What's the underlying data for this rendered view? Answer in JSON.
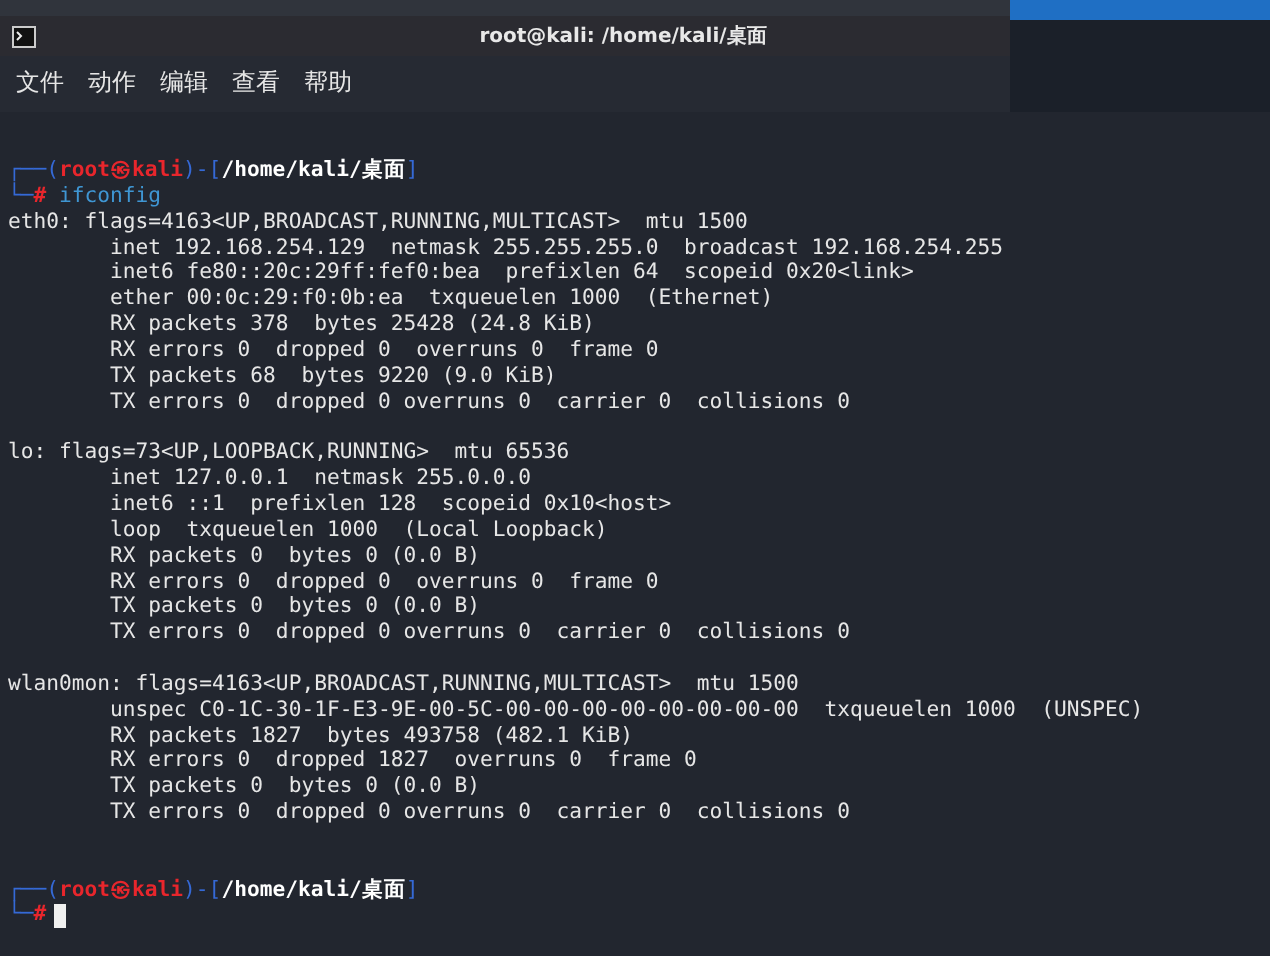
{
  "window": {
    "title": "root@kali: /home/kali/桌面"
  },
  "menu": [
    "文件",
    "动作",
    "编辑",
    "查看",
    "帮助"
  ],
  "terminal": [
    {
      "kind": "prompt",
      "cursor": false,
      "segments": [
        {
          "text": "┌──(",
          "color": "#3569d6"
        },
        {
          "text": "root㉿kali",
          "color": "#e8262c"
        },
        {
          "text": ")-[",
          "color": "#3569d6"
        },
        {
          "text": "/home/kali/桌面",
          "color": "#ffffff"
        },
        {
          "text": "]",
          "color": "#3569d6"
        }
      ],
      "input": [
        {
          "text": "└─",
          "color": "#3569d6"
        },
        {
          "text": "#",
          "color": "#e8262c"
        },
        {
          "text": " ifconfig",
          "color": "#3f96d3"
        }
      ]
    },
    {
      "kind": "output",
      "text": "eth0: flags=4163<UP,BROADCAST,RUNNING,MULTICAST>  mtu 1500"
    },
    {
      "kind": "output",
      "text": "        inet 192.168.254.129  netmask 255.255.255.0  broadcast 192.168.254.255"
    },
    {
      "kind": "output",
      "text": "        inet6 fe80::20c:29ff:fef0:bea  prefixlen 64  scopeid 0x20<link>"
    },
    {
      "kind": "output",
      "text": "        ether 00:0c:29:f0:0b:ea  txqueuelen 1000  (Ethernet)"
    },
    {
      "kind": "output",
      "text": "        RX packets 378  bytes 25428 (24.8 KiB)"
    },
    {
      "kind": "output",
      "text": "        RX errors 0  dropped 0  overruns 0  frame 0"
    },
    {
      "kind": "output",
      "text": "        TX packets 68  bytes 9220 (9.0 KiB)"
    },
    {
      "kind": "output",
      "text": "        TX errors 0  dropped 0 overruns 0  carrier 0  collisions 0"
    },
    {
      "kind": "blank"
    },
    {
      "kind": "output",
      "text": "lo: flags=73<UP,LOOPBACK,RUNNING>  mtu 65536"
    },
    {
      "kind": "output",
      "text": "        inet 127.0.0.1  netmask 255.0.0.0"
    },
    {
      "kind": "output",
      "text": "        inet6 ::1  prefixlen 128  scopeid 0x10<host>"
    },
    {
      "kind": "output",
      "text": "        loop  txqueuelen 1000  (Local Loopback)"
    },
    {
      "kind": "output",
      "text": "        RX packets 0  bytes 0 (0.0 B)"
    },
    {
      "kind": "output",
      "text": "        RX errors 0  dropped 0  overruns 0  frame 0"
    },
    {
      "kind": "output",
      "text": "        TX packets 0  bytes 0 (0.0 B)"
    },
    {
      "kind": "output",
      "text": "        TX errors 0  dropped 0 overruns 0  carrier 0  collisions 0"
    },
    {
      "kind": "blank"
    },
    {
      "kind": "output",
      "text": "wlan0mon: flags=4163<UP,BROADCAST,RUNNING,MULTICAST>  mtu 1500"
    },
    {
      "kind": "output",
      "text": "        unspec C0-1C-30-1F-E3-9E-00-5C-00-00-00-00-00-00-00-00  txqueuelen 1000  (UNSPEC)"
    },
    {
      "kind": "output",
      "text": "        RX packets 1827  bytes 493758 (482.1 KiB)"
    },
    {
      "kind": "output",
      "text": "        RX errors 0  dropped 1827  overruns 0  frame 0"
    },
    {
      "kind": "output",
      "text": "        TX packets 0  bytes 0 (0.0 B)"
    },
    {
      "kind": "output",
      "text": "        TX errors 0  dropped 0 overruns 0  carrier 0  collisions 0"
    },
    {
      "kind": "blank"
    },
    {
      "kind": "blank"
    },
    {
      "kind": "prompt",
      "cursor": true,
      "segments": [
        {
          "text": "┌──(",
          "color": "#3569d6"
        },
        {
          "text": "root㉿kali",
          "color": "#e8262c"
        },
        {
          "text": ")-[",
          "color": "#3569d6"
        },
        {
          "text": "/home/kali/桌面",
          "color": "#ffffff"
        },
        {
          "text": "]",
          "color": "#3569d6"
        }
      ],
      "input": [
        {
          "text": "└─",
          "color": "#3569d6"
        },
        {
          "text": "#",
          "color": "#e8262c"
        }
      ]
    }
  ]
}
